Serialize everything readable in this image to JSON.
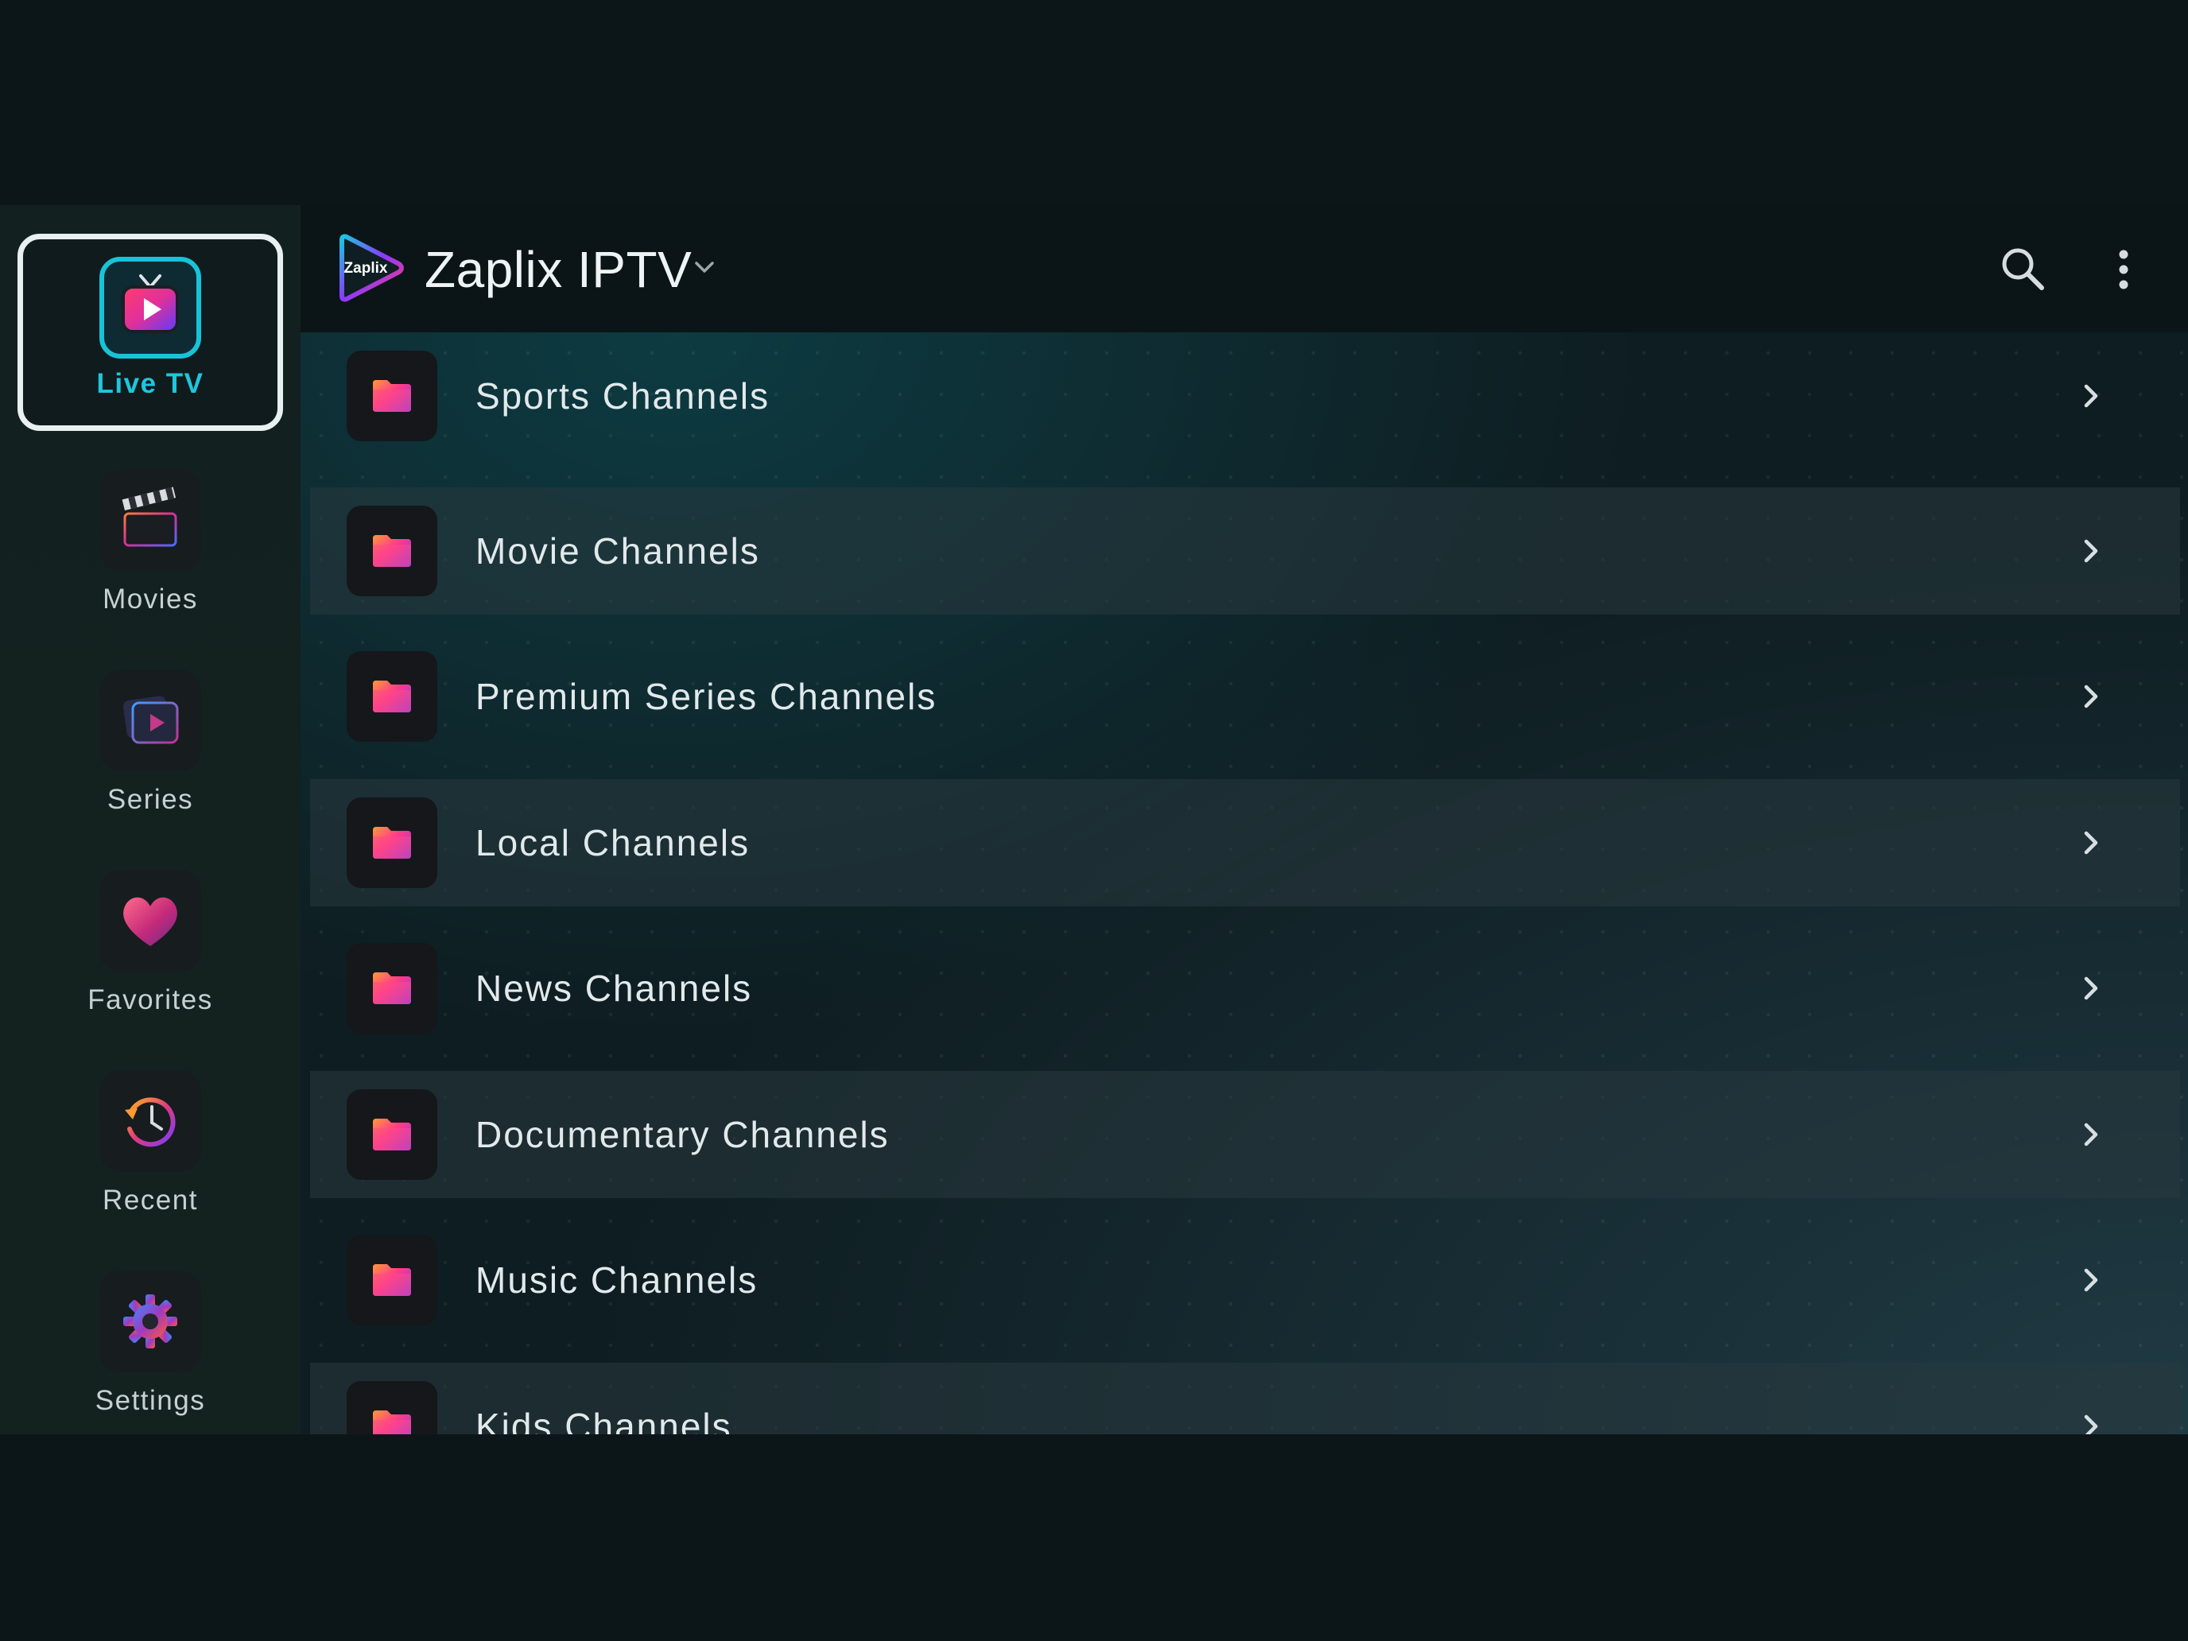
{
  "header": {
    "logo_text": "Zaplix",
    "title": "Zaplix IPTV",
    "chevron_icon": "chevron-down-icon",
    "search_icon": "search-icon",
    "more_icon": "more-vertical-icon"
  },
  "sidebar": {
    "items": [
      {
        "label": "Live TV",
        "icon": "tv-icon",
        "active": true
      },
      {
        "label": "Movies",
        "icon": "clapperboard-icon"
      },
      {
        "label": "Series",
        "icon": "series-play-icon"
      },
      {
        "label": "Favorites",
        "icon": "heart-icon"
      },
      {
        "label": "Recent",
        "icon": "history-icon"
      },
      {
        "label": "Settings",
        "icon": "gear-icon"
      }
    ]
  },
  "categories": [
    {
      "label": "Sports Channels",
      "icon": "folder-icon"
    },
    {
      "label": "Movie Channels",
      "icon": "folder-icon"
    },
    {
      "label": "Premium Series Channels",
      "icon": "folder-icon"
    },
    {
      "label": "Local Channels",
      "icon": "folder-icon"
    },
    {
      "label": "News Channels",
      "icon": "folder-icon"
    },
    {
      "label": "Documentary Channels",
      "icon": "folder-icon"
    },
    {
      "label": "Music Channels",
      "icon": "folder-icon"
    },
    {
      "label": "Kids Channels",
      "icon": "folder-icon"
    }
  ],
  "colors": {
    "accent": "#1fc6dc",
    "background": "#0b1518",
    "focus_border": "#e9f0f2"
  }
}
